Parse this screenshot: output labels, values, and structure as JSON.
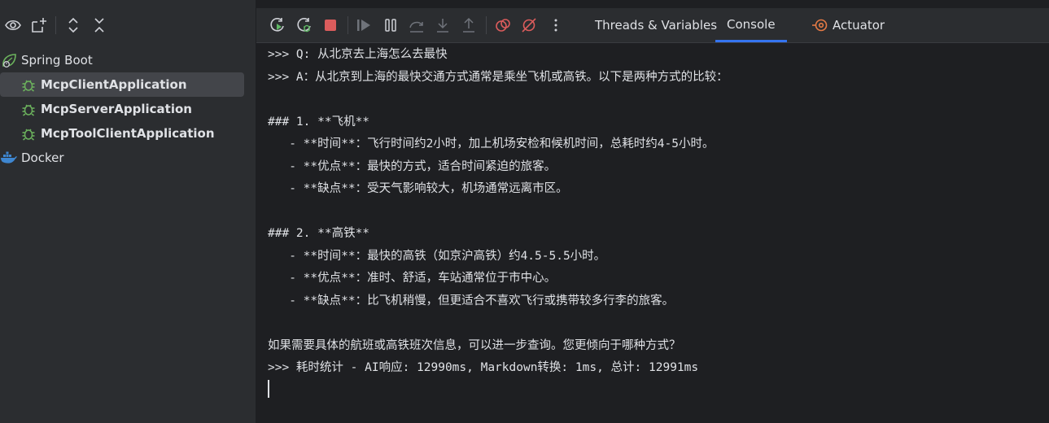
{
  "colors": {
    "panel_bg": "#2b2d30",
    "console_bg": "#1e1f22",
    "accent_tab": "#3574f0",
    "spring_green": "#6cb35d",
    "rerun_green": "#5fb865",
    "stop_red": "#db5c5c",
    "docker_blue": "#3e86d0",
    "actuator_orange": "#e57a45"
  },
  "left_toolbar": {
    "icons": [
      "eye-icon",
      "new-service-icon",
      "expand-all-icon",
      "collapse-all-icon"
    ]
  },
  "services_tree": [
    {
      "label": "Spring Boot",
      "icon": "spring-boot-icon",
      "level": 0
    },
    {
      "label": "McpClientApplication",
      "icon": "bug-icon",
      "level": 1,
      "selected": true
    },
    {
      "label": "McpServerApplication",
      "icon": "bug-icon",
      "level": 1
    },
    {
      "label": "McpToolClientApplication",
      "icon": "bug-icon",
      "level": 1
    },
    {
      "label": "Docker",
      "icon": "docker-icon",
      "level": 0
    }
  ],
  "debug_toolbar": {
    "icons": [
      "rerun-icon",
      "rerun-debug-icon",
      "stop-icon",
      "resume-icon",
      "pause-icon",
      "step-over-icon",
      "step-into-icon",
      "step-out-icon",
      "view-breakpoints-icon",
      "mute-breakpoints-icon",
      "more-icon"
    ]
  },
  "tabs": [
    {
      "label": "Threads & Variables",
      "active": false
    },
    {
      "label": "Console",
      "active": true
    },
    {
      "label": "Actuator",
      "active": false,
      "icon": "actuator-icon"
    }
  ],
  "console_lines": [
    ">>> Q: 从北京去上海怎么去最快",
    ">>> A：从北京到上海的最快交通方式通常是乘坐飞机或高铁。以下是两种方式的比较：",
    "",
    "### 1. **飞机**",
    "   - **时间**：飞行时间约2小时，加上机场安检和候机时间，总耗时约4-5小时。",
    "   - **优点**：最快的方式，适合时间紧迫的旅客。",
    "   - **缺点**：受天气影响较大，机场通常远离市区。",
    "",
    "### 2. **高铁**",
    "   - **时间**：最快的高铁（如京沪高铁）约4.5-5.5小时。",
    "   - **优点**：准时、舒适，车站通常位于市中心。",
    "   - **缺点**：比飞机稍慢，但更适合不喜欢飞行或携带较多行李的旅客。",
    "",
    "如果需要具体的航班或高铁班次信息，可以进一步查询。您更倾向于哪种方式？",
    ">>> 耗时统计 - AI响应: 12990ms, Markdown转换: 1ms, 总计: 12991ms"
  ]
}
